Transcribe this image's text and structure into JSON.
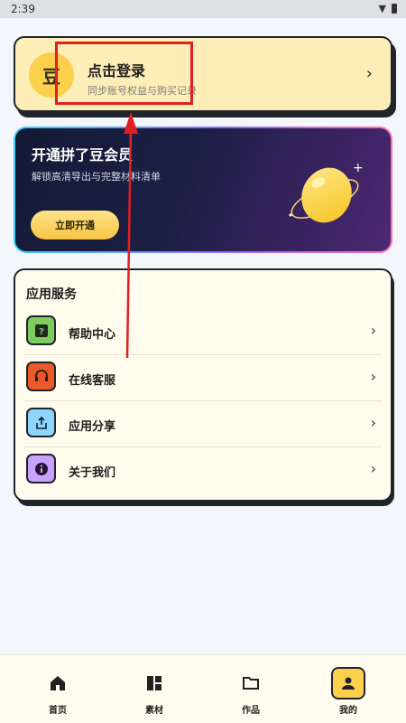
{
  "status_bar": {
    "time": "2:39"
  },
  "login_card": {
    "avatar_char": "豆",
    "title": "点击登录",
    "subtitle": "同步账号权益与购买记录",
    "chevron": "›"
  },
  "member_banner": {
    "title": "开通拼了豆会员",
    "subtitle": "解锁高清导出与完整材料清单",
    "button": "立即开通"
  },
  "services": {
    "title": "应用服务",
    "items": [
      {
        "label": "帮助中心",
        "icon": "help-icon",
        "color": "#7ecb5f"
      },
      {
        "label": "在线客服",
        "icon": "headset-icon",
        "color": "#e85a2a"
      },
      {
        "label": "应用分享",
        "icon": "share-icon",
        "color": "#8fd6ff"
      },
      {
        "label": "关于我们",
        "icon": "info-icon",
        "color": "#c9a3ff"
      }
    ],
    "chevron": "›"
  },
  "bottom_nav": {
    "items": [
      {
        "label": "首页",
        "icon": "home-icon"
      },
      {
        "label": "素材",
        "icon": "dashboard-icon"
      },
      {
        "label": "作品",
        "icon": "folder-icon"
      },
      {
        "label": "我的",
        "icon": "person-icon",
        "active": true
      }
    ]
  },
  "colors": {
    "accent": "#fcd04b",
    "highlight": "#e02020",
    "login_bg": "#fdeeb8"
  }
}
